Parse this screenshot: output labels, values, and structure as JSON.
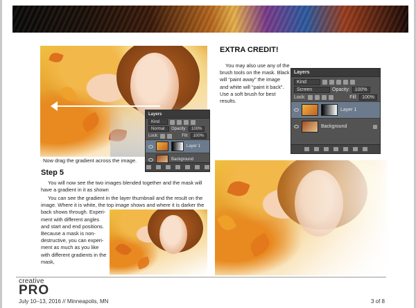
{
  "caption": "Now drag the gradient across the image.",
  "step": {
    "heading": "Step 5",
    "para1": "You will now see the two images blended together and the mask will have a gradient in it as shown",
    "para2_line1": "You can see the gradient in the layer thumbnail and the result on the",
    "para2_line2": "image. Where it is white, the top image shows and where it is darker the",
    "para2_line3": "back shows through. Experi-",
    "para2_line4": "ment with different angles",
    "para2_line5": "and start and end positions.",
    "para2_line6": "Because a mask is non-",
    "para2_line7": "destructive, you can experi-",
    "para2_line8": "ment as much as you like",
    "para2_line9": "with different gradients in the",
    "para2_line10": "mask,"
  },
  "extra": {
    "title": "EXTRA CREDIT!",
    "line1": "You may also use any of the",
    "line2": "brush tools on the mask. Black",
    "line3": "will “paint away” the image",
    "line4": "and white will “paint it back”.",
    "line5": "Use a soft brush for best",
    "line6": "results."
  },
  "layers_panel_large": {
    "tab": "Layers",
    "kind": "Kind",
    "blend": "Screen",
    "opacity_label": "Opacity:",
    "opacity_value": "100%",
    "lock_label": "Lock:",
    "fill_label": "Fill:",
    "fill_value": "100%",
    "layers": [
      "Layer 1",
      "Background"
    ]
  },
  "layers_panel_small": {
    "tab": "Layers",
    "kind": "Kind",
    "blend": "Normal",
    "opacity_label": "Opacity:",
    "opacity_value": "100%",
    "lock_label": "Lock:",
    "fill_label": "Fill:",
    "fill_value": "100%",
    "layers": [
      "Layer 1",
      "Background"
    ]
  },
  "footer": {
    "logo_top": "creative",
    "logo_bottom": "PRO",
    "event": "July 10–13, 2016 // Minneapolis, MN",
    "page": "3 of 8"
  }
}
